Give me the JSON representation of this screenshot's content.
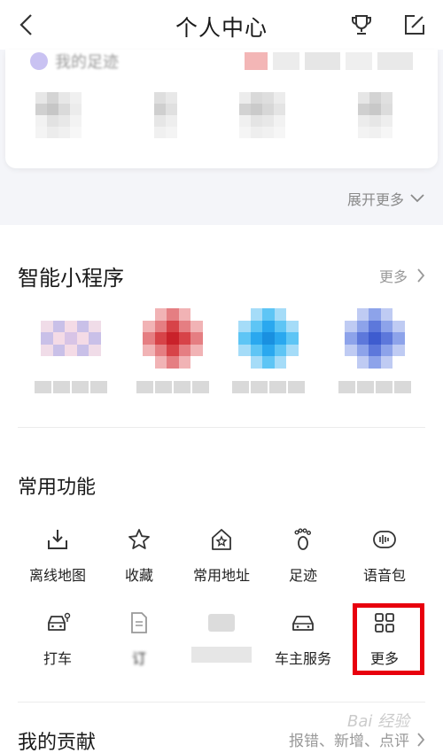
{
  "header": {
    "title": "个人中心",
    "back_icon": "back-arrow-icon",
    "trophy_icon": "trophy-icon",
    "edit_icon": "edit-icon"
  },
  "footprint": {
    "title": "我的足迹",
    "expand_label": "展开更多"
  },
  "mini_programs": {
    "title": "智能小程序",
    "more_label": "更多",
    "items": [
      {
        "colors": [
          "#f4dbe6",
          "#c9c0e8",
          "#d8c4e6",
          "#f0dce8"
        ]
      },
      {
        "colors": [
          "#d74348",
          "#e57e82",
          "#c9212a",
          "#f1b3b5"
        ]
      },
      {
        "colors": [
          "#2aa8ef",
          "#5ec5f5",
          "#1990e0",
          "#a5dcf8"
        ]
      },
      {
        "colors": [
          "#5d78db",
          "#8da3ea",
          "#3e5ccf",
          "#bfcbf3"
        ]
      }
    ]
  },
  "functions": {
    "title": "常用功能",
    "items": [
      {
        "label": "离线地图",
        "icon": "offline-map-icon"
      },
      {
        "label": "收藏",
        "icon": "star-icon"
      },
      {
        "label": "常用地址",
        "icon": "home-star-icon"
      },
      {
        "label": "足迹",
        "icon": "footprint-icon"
      },
      {
        "label": "语音包",
        "icon": "voice-pack-icon"
      },
      {
        "label": "打车",
        "icon": "taxi-icon"
      },
      {
        "label": "订",
        "icon": "order-icon"
      },
      {
        "label": "",
        "icon": "blurred-icon"
      },
      {
        "label": "车主服务",
        "icon": "car-icon"
      },
      {
        "label": "更多",
        "icon": "grid-icon"
      }
    ]
  },
  "contribution": {
    "title": "我的贡献",
    "right_label": "报错、新增、点评"
  },
  "watermark": "Bai 经验",
  "colors": {
    "highlight": "#e8000d",
    "section_bg": "#f4f5f9",
    "muted_text": "#999999"
  }
}
